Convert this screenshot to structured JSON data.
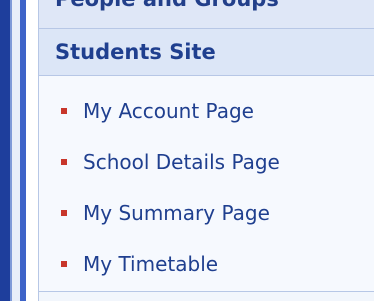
{
  "quick_launch": {
    "previous_section_label": "People and Groups",
    "section_title": "Students Site",
    "bullet_color": "#c8362b",
    "link_color": "#1f3f8f",
    "items": [
      {
        "label": "My Account Page"
      },
      {
        "label": "School Details Page"
      },
      {
        "label": "My Summary Page"
      },
      {
        "label": "My Timetable"
      }
    ]
  }
}
